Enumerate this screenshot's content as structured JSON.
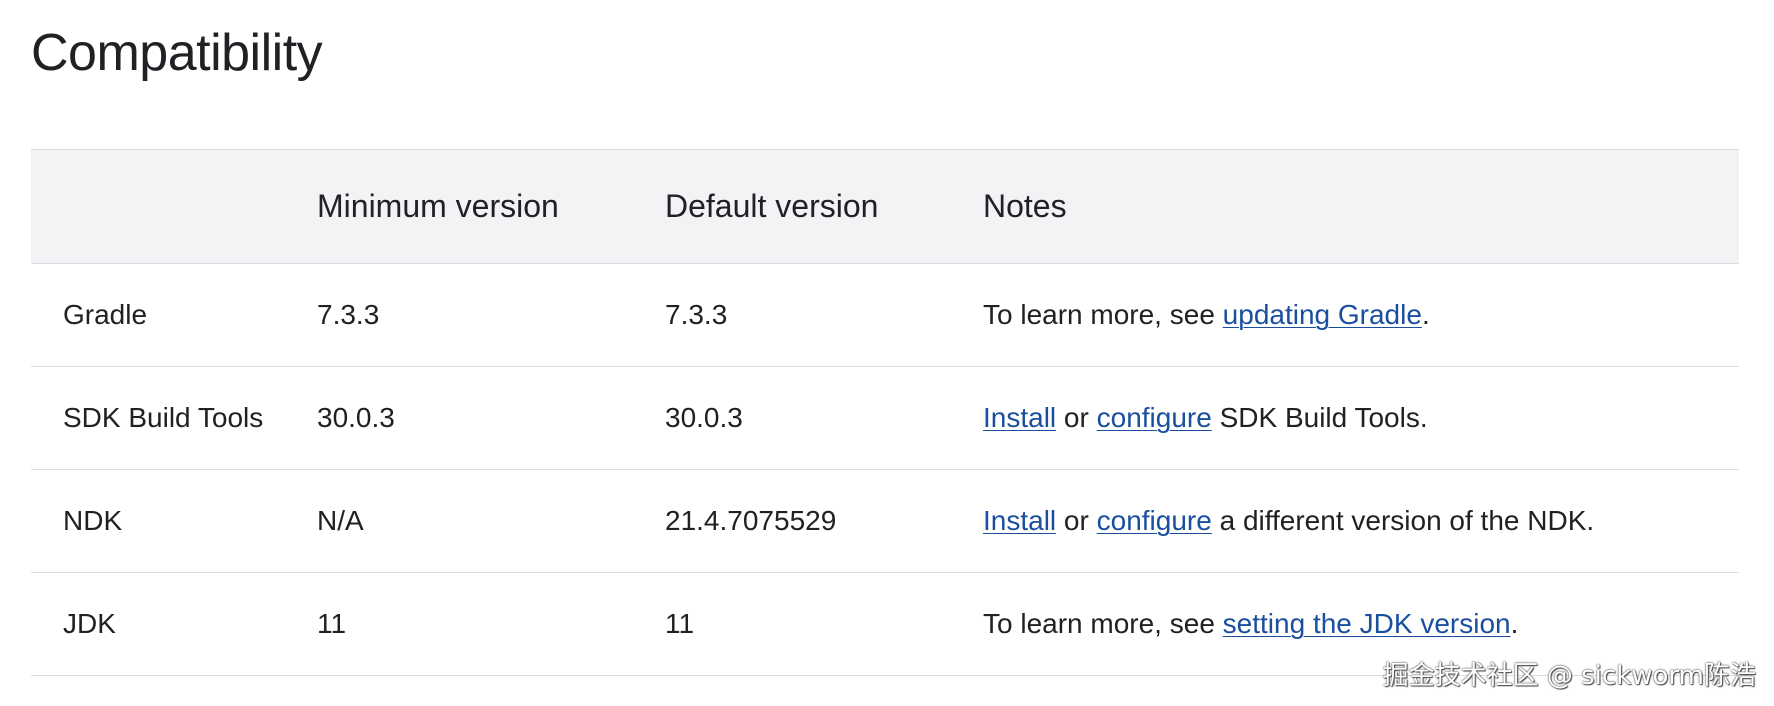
{
  "title": "Compatibility",
  "table": {
    "headers": [
      "",
      "Minimum version",
      "Default version",
      "Notes"
    ],
    "rows": [
      {
        "name": "Gradle",
        "min": "7.3.3",
        "default": "7.3.3",
        "notes": {
          "before": "To learn more, see ",
          "link1": "updating Gradle",
          "middle": "",
          "link2": "",
          "after": "."
        }
      },
      {
        "name": "SDK Build Tools",
        "min": "30.0.3",
        "default": "30.0.3",
        "notes": {
          "before": "",
          "link1": "Install",
          "middle": " or ",
          "link2": "configure",
          "after": " SDK Build Tools."
        }
      },
      {
        "name": "NDK",
        "min": "N/A",
        "default": "21.4.7075529",
        "notes": {
          "before": "",
          "link1": "Install",
          "middle": " or ",
          "link2": "configure",
          "after": " a different version of the NDK."
        }
      },
      {
        "name": "JDK",
        "min": "11",
        "default": "11",
        "notes": {
          "before": "To learn more, see ",
          "link1": "setting the JDK version",
          "middle": "",
          "link2": "",
          "after": "."
        }
      }
    ]
  },
  "watermark": "掘金技术社区 @ sickworm陈浩",
  "colors": {
    "link": "#1a4fa0",
    "header_bg": "#f1f3f4",
    "border": "#dadce0",
    "text": "#202124"
  }
}
